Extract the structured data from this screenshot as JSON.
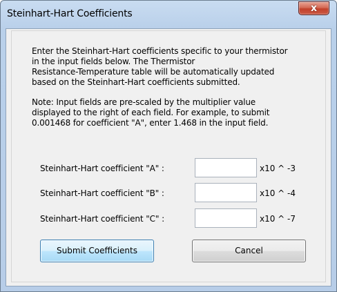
{
  "window": {
    "title": "Steinhart-Hart Coefficients",
    "close_icon": "close-icon",
    "close_glyph": "x"
  },
  "instructions": {
    "lines": [
      "Enter the Steinhart-Hart coefficients specific to your thermistor",
      "in the input fields below. The Thermistor",
      "Resistance-Temperature table will be automatically updated",
      "based on the Steinhart-Hart coefficients submitted."
    ]
  },
  "note": {
    "lines": [
      "Note: Input fields are pre-scaled by the multiplier value",
      "displayed to the right of each field. For example, to submit",
      "0.001468 for coefficient \"A\", enter 1.468 in the input field."
    ]
  },
  "coefficients": [
    {
      "label": "Steinhart-Hart coefficient  \"A\"  :",
      "value": "",
      "multiplier": "x10 ^ -3"
    },
    {
      "label": "Steinhart-Hart coefficient  \"B\"  :",
      "value": "",
      "multiplier": "x10 ^ -4"
    },
    {
      "label": "Steinhart-Hart coefficient  \"C\"  :",
      "value": "",
      "multiplier": "x10 ^ -7"
    }
  ],
  "buttons": {
    "submit_label": "Submit Coefficients",
    "cancel_label": "Cancel"
  },
  "colors": {
    "title_bar": "#b9d0ea",
    "close_button": "#c2412b",
    "client_bg": "#f0f0f0",
    "default_button_border": "#3c7fb1"
  }
}
